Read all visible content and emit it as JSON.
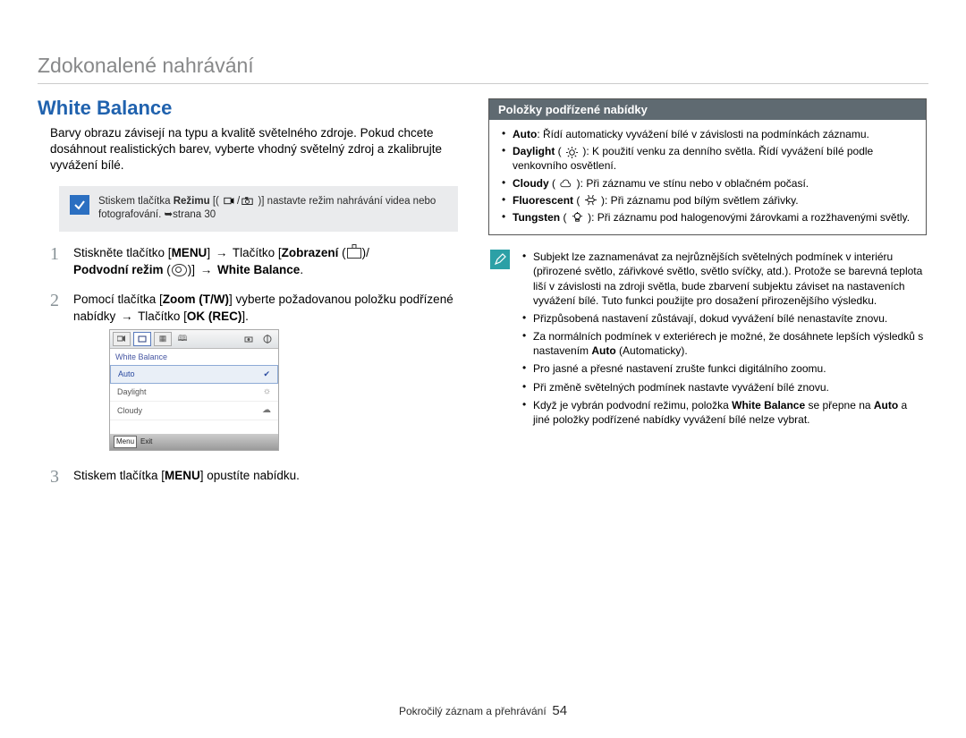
{
  "chapter": "Zdokonalené nahrávání",
  "topic": "White Balance",
  "intro": "Barvy obrazu závisejí na typu a kvalitě světelného zdroje. Pokud chcete dosáhnout realistických barev, vyberte vhodný světelný zdroj a zkalibrujte vyvážení bílé.",
  "modeNote": {
    "pre": "Stiskem tlačítka ",
    "strong": "Režimu",
    "post1": " [( ",
    "post2": " )] nastavte režim nahrávání videa nebo fotografování. ",
    "pageRef": "➥strana 30"
  },
  "steps": {
    "s1": {
      "a": "Stiskněte tlačítko [",
      "menu": "MENU",
      "b": "] ",
      "arrow": "→",
      "c": " Tlačítko [",
      "zobr": "Zobrazení",
      "d": " (",
      "e": ")/",
      "podv": "Podvodní režim",
      "f": " (",
      "g": ")] ",
      "wb": "White Balance",
      "h": "."
    },
    "s2": {
      "a": "Pomocí tlačítka [",
      "zoom": "Zoom (T/W)",
      "b": "] vyberte požadovanou položku podřízené nabídky ",
      "arrow": "→",
      "c": " Tlačítko [",
      "ok": "OK (REC)",
      "d": "]."
    },
    "s3": {
      "a": "Stiskem tlačítka [",
      "menu": "MENU",
      "b": "] opustíte nabídku."
    }
  },
  "menushot": {
    "title": "White Balance",
    "items": [
      "Auto",
      "Daylight",
      "Cloudy"
    ],
    "footMenu": "Menu",
    "footExit": "Exit"
  },
  "submenu": {
    "head": "Položky podřízené nabídky",
    "items": [
      {
        "name": "Auto",
        "icon": "",
        "text": ": Řídí automaticky vyvážení bílé v závislosti na podmínkách záznamu."
      },
      {
        "name": "Daylight",
        "icon": "sun",
        "text": ": K použití venku za denního světla. Řídí vyvážení bílé podle venkovního osvětlení."
      },
      {
        "name": "Cloudy",
        "icon": "cloud",
        "text": ": Při záznamu ve stínu nebo v oblačném počasí."
      },
      {
        "name": "Fluorescent",
        "icon": "bulb",
        "text": ": Při záznamu pod bílým světlem zářivky."
      },
      {
        "name": "Tungsten",
        "icon": "lamp",
        "text": ": Při záznamu pod halogenovými žárovkami a rozžhavenými světly."
      }
    ]
  },
  "notes2": [
    "Subjekt lze zaznamenávat za nejrůznějších světelných podmínek v interiéru (přirozené světlo, zářivkové světlo, světlo svíčky, atd.). Protože se barevná teplota liší v závislosti na zdroji světla, bude zbarvení subjektu záviset na nastaveních vyvážení bílé. Tuto funkci použijte pro dosažení přirozenějšího výsledku.",
    "Přizpůsobená nastavení zůstávají, dokud vyvážení bílé nenastavíte znovu.",
    "Za normálních podmínek v exteriérech je možné, že dosáhnete lepších výsledků s nastavením <b>Auto</b> (Automaticky).",
    "Pro jasné a přesné nastavení zrušte funkci digitálního zoomu.",
    "Při změně světelných podmínek nastavte vyvážení bílé znovu.",
    "Když je vybrán podvodní režimu, položka <b>White Balance</b> se přepne na <b>Auto</b> a jiné položky podřízené nabídky vyvážení bílé nelze vybrat."
  ],
  "footer": {
    "text": "Pokročilý záznam a přehrávání",
    "page": "54"
  }
}
